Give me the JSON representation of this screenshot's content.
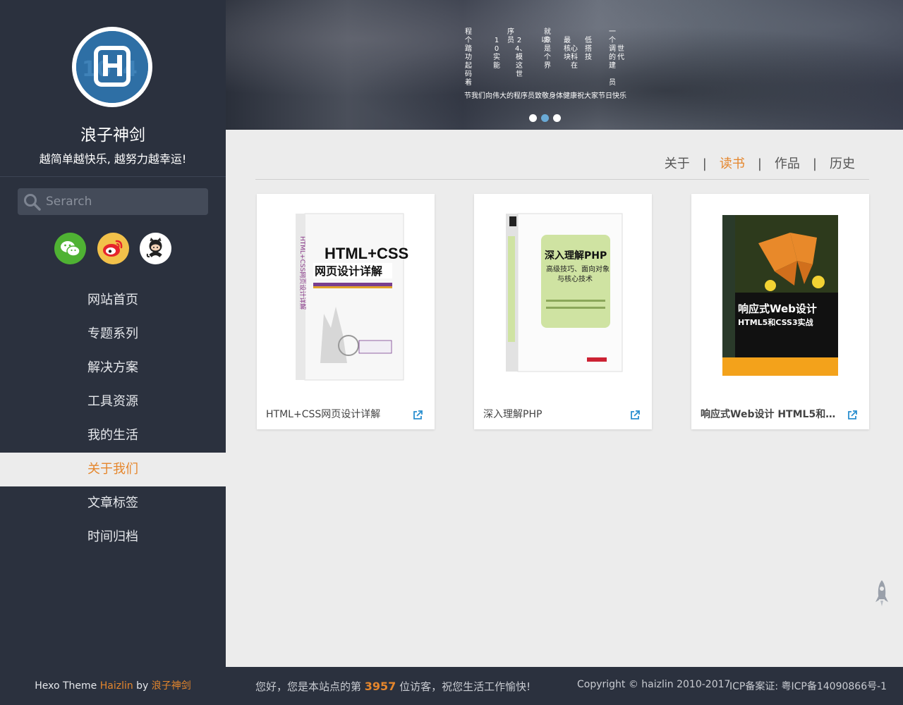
{
  "sidebar": {
    "site_title": "浪子神剑",
    "motto": "越简单越快乐, 越努力越幸运!",
    "search_placeholder": "Serarch",
    "social": [
      "wechat-icon",
      "weibo-icon",
      "github-icon"
    ],
    "nav": [
      {
        "label": "网站首页",
        "active": false
      },
      {
        "label": "专题系列",
        "active": false
      },
      {
        "label": "解决方案",
        "active": false
      },
      {
        "label": "工具资源",
        "active": false
      },
      {
        "label": "我的生活",
        "active": false
      },
      {
        "label": "关于我们",
        "active": true
      },
      {
        "label": "文章标签",
        "active": false
      },
      {
        "label": "时间归档",
        "active": false
      }
    ],
    "footer": {
      "prefix": "Hexo Theme ",
      "theme": "Haizlin",
      "by": " by ",
      "author": "浪子神剑"
    }
  },
  "banner": {
    "poem_columns": [
      "程个踏功起码着",
      "序员",
      "10实能",
      "24、模这世",
      "就像是个界",
      "以",
      "最核块",
      "心科在",
      "低搭技",
      "一个调的建",
      "世代",
      "员"
    ],
    "caption": "节我们向伟大的程序员致敬身体健康祝大家节日快乐",
    "dots": 3,
    "active_dot": 1
  },
  "tabs": {
    "items": [
      {
        "label": "关于",
        "active": false
      },
      {
        "label": "读书",
        "active": true
      },
      {
        "label": "作品",
        "active": false
      },
      {
        "label": "历史",
        "active": false
      }
    ]
  },
  "books": [
    {
      "title": "HTML+CSS网页设计详解",
      "bold": false
    },
    {
      "title": "深入理解PHP",
      "bold": false
    },
    {
      "title": "响应式Web设计 HTML5和CSS3实战",
      "bold": true
    }
  ],
  "footer": {
    "visit_prefix": "您好，您是本站点的第 ",
    "visit_count": "3957",
    "visit_suffix": " 位访客，祝您生活工作愉快!",
    "copyright": "Copyright © haizlin 2010-2017",
    "icp": "ICP备案证: 粤ICP备14090866号-1"
  },
  "colors": {
    "accent": "#e5862c",
    "sidebar_bg": "#2b313e",
    "link_blue": "#2a8fcf"
  }
}
